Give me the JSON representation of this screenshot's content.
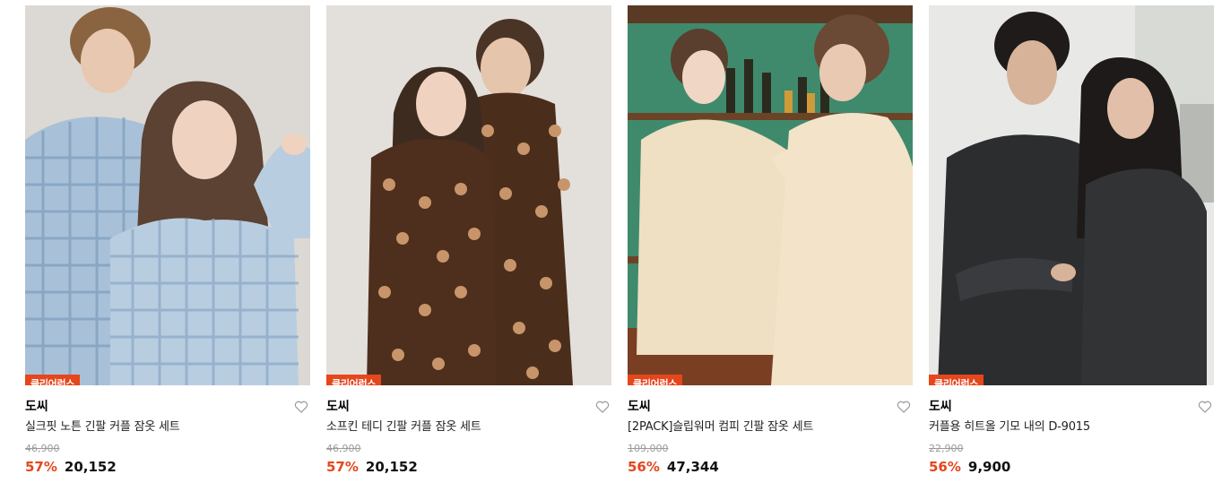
{
  "products": [
    {
      "badge": "클리어런스",
      "brand": "도씨",
      "name": "실크핏 노튼 긴팔 커플 잠옷 세트",
      "original_price": "46,900",
      "discount": "57%",
      "price": "20,152",
      "image_desc": "plaid-blue-pajama-couple"
    },
    {
      "badge": "클리어런스",
      "brand": "도씨",
      "name": "소프킨 테디 긴팔 커플 잠옷 세트",
      "original_price": "46,900",
      "discount": "57%",
      "price": "20,152",
      "image_desc": "brown-teddy-pajama-couple"
    },
    {
      "badge": "클리어런스",
      "brand": "도씨",
      "name": "[2PACK]슬립워머 컴피 긴팔 잠옷 세트",
      "original_price": "109,000",
      "discount": "56%",
      "price": "47,344",
      "image_desc": "cream-pajama-couple-bar"
    },
    {
      "badge": "클리어런스",
      "brand": "도씨",
      "name": "커플용 히트올 기모 내의 D-9015",
      "original_price": "22,900",
      "discount": "56%",
      "price": "9,900",
      "image_desc": "black-thermal-couple"
    }
  ],
  "colors": {
    "badge_bg": "#e6461c",
    "discount": "#e6461c",
    "original_price": "#9a9a9a"
  },
  "icons": {
    "wishlist": "heart-outline-icon"
  }
}
